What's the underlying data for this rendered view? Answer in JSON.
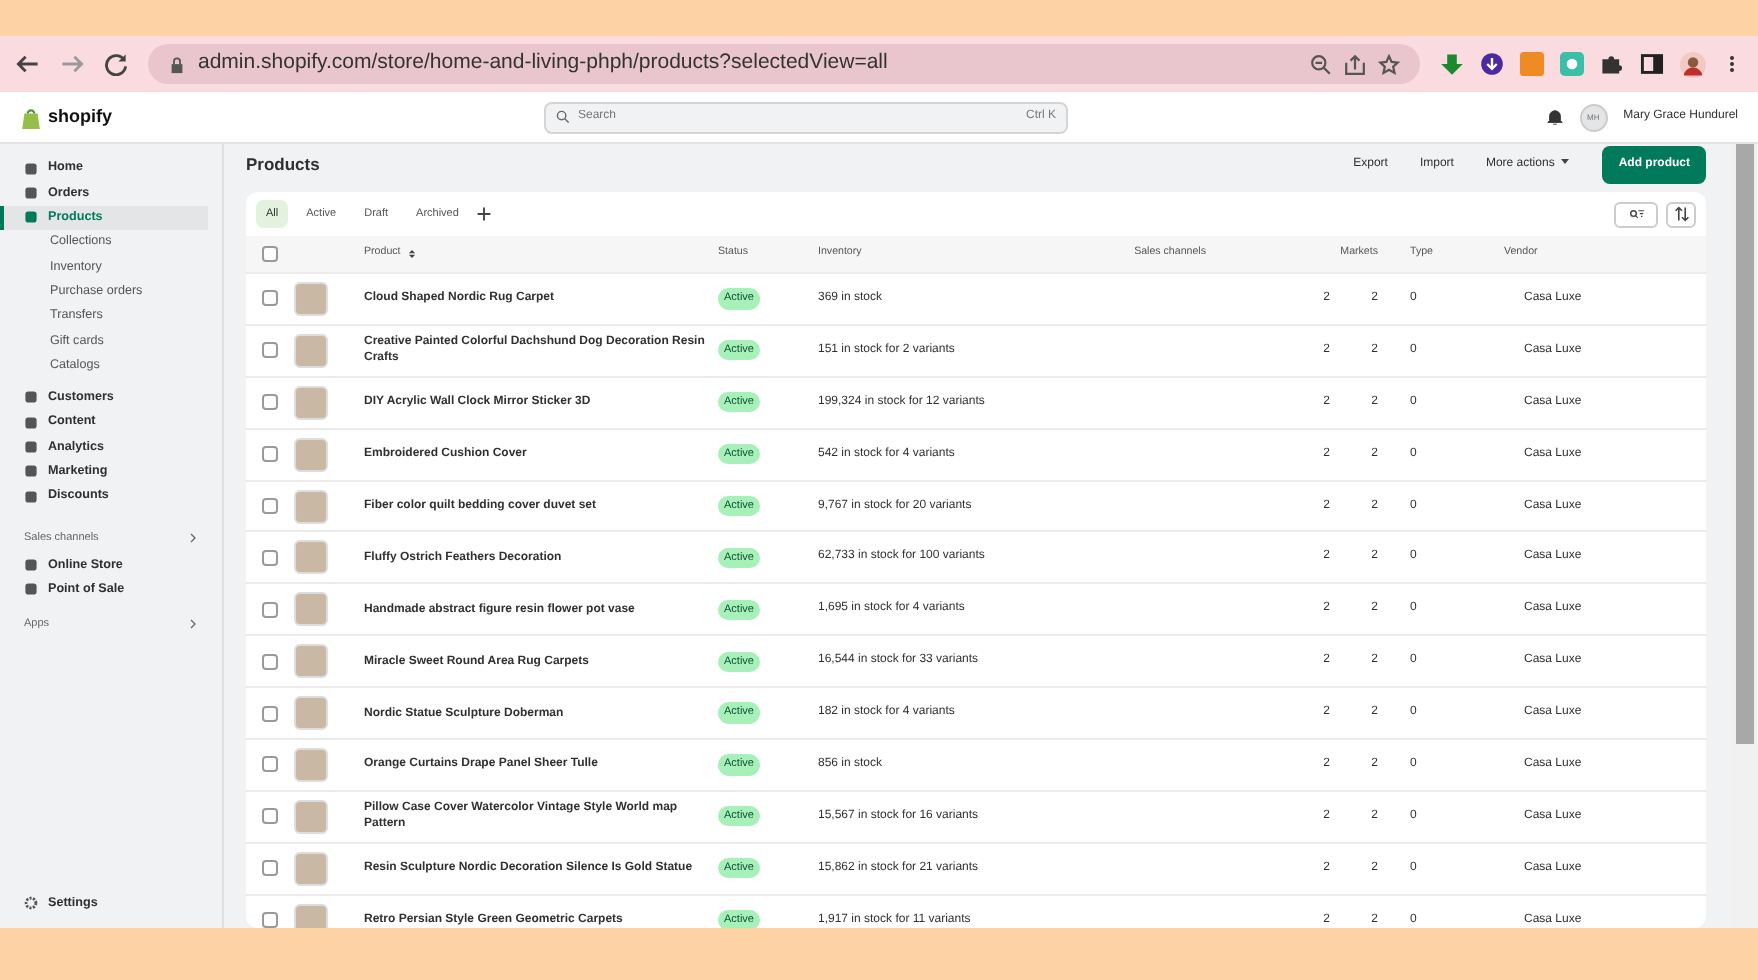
{
  "browser": {
    "url": "admin.shopify.com/store/home-and-living-phph/products?selectedView=all"
  },
  "topbar": {
    "logo": "shopify",
    "search": {
      "placeholder": "Search",
      "shortcut": "Ctrl K"
    },
    "avatar_initials": "MH",
    "user": "Mary Grace Hundurel"
  },
  "sidebar": {
    "items": [
      {
        "label": "Home",
        "kind": "main",
        "selected": false
      },
      {
        "label": "Orders",
        "kind": "main",
        "selected": false
      },
      {
        "label": "Products",
        "kind": "main",
        "selected": true
      },
      {
        "label": "Collections",
        "kind": "sub",
        "selected": false
      },
      {
        "label": "Inventory",
        "kind": "sub",
        "selected": false
      },
      {
        "label": "Purchase orders",
        "kind": "sub",
        "selected": false
      },
      {
        "label": "Transfers",
        "kind": "sub",
        "selected": false
      },
      {
        "label": "Gift cards",
        "kind": "sub",
        "selected": false
      },
      {
        "label": "Catalogs",
        "kind": "sub",
        "selected": false
      },
      {
        "label": "Customers",
        "kind": "main",
        "selected": false
      },
      {
        "label": "Content",
        "kind": "main",
        "selected": false
      },
      {
        "label": "Analytics",
        "kind": "main",
        "selected": false
      },
      {
        "label": "Marketing",
        "kind": "main",
        "selected": false
      },
      {
        "label": "Discounts",
        "kind": "main",
        "selected": false
      },
      {
        "label": "Sales channels",
        "kind": "section"
      },
      {
        "label": "Online Store",
        "kind": "main",
        "selected": false
      },
      {
        "label": "Point of Sale",
        "kind": "main",
        "selected": false
      },
      {
        "label": "Apps",
        "kind": "section"
      }
    ],
    "settings": "Settings"
  },
  "page": {
    "title": "Products",
    "actions": [
      "Export",
      "Import",
      "More actions"
    ],
    "primary": "Add product"
  },
  "tabs": [
    {
      "label": "All",
      "selected": true
    },
    {
      "label": "Active",
      "selected": false
    },
    {
      "label": "Draft",
      "selected": false
    },
    {
      "label": "Archived",
      "selected": false
    }
  ],
  "table": {
    "select_all_checked": false,
    "columns": [
      "Product",
      "Status",
      "Inventory",
      "Sales channels",
      "Markets",
      "Type",
      "Vendor"
    ],
    "rows": [
      {
        "product": "Cloud Shaped Nordic Rug Carpet",
        "status": "Active",
        "inventory": "369 in stock",
        "sales_channels": "2",
        "markets": "2",
        "type": "0",
        "vendor": "Casa Luxe",
        "checked": false
      },
      {
        "product": "Creative Painted Colorful Dachshund Dog Decoration Resin Crafts",
        "status": "Active",
        "inventory": "151 in stock for 2 variants",
        "sales_channels": "2",
        "markets": "2",
        "type": "0",
        "vendor": "Casa Luxe",
        "checked": false
      },
      {
        "product": "DIY Acrylic Wall Clock Mirror Sticker 3D",
        "status": "Active",
        "inventory": "199,324 in stock for 12 variants",
        "sales_channels": "2",
        "markets": "2",
        "type": "0",
        "vendor": "Casa Luxe",
        "checked": false
      },
      {
        "product": "Embroidered Cushion Cover",
        "status": "Active",
        "inventory": "542 in stock for 4 variants",
        "sales_channels": "2",
        "markets": "2",
        "type": "0",
        "vendor": "Casa Luxe",
        "checked": false
      },
      {
        "product": "Fiber color quilt bedding cover duvet set",
        "status": "Active",
        "inventory": "9,767 in stock for 20 variants",
        "sales_channels": "2",
        "markets": "2",
        "type": "0",
        "vendor": "Casa Luxe",
        "checked": false
      },
      {
        "product": "Fluffy Ostrich Feathers Decoration",
        "status": "Active",
        "inventory": "62,733 in stock for 100 variants",
        "sales_channels": "2",
        "markets": "2",
        "type": "0",
        "vendor": "Casa Luxe",
        "checked": false
      },
      {
        "product": "Handmade abstract figure resin flower pot vase",
        "status": "Active",
        "inventory": "1,695 in stock for 4 variants",
        "sales_channels": "2",
        "markets": "2",
        "type": "0",
        "vendor": "Casa Luxe",
        "checked": false
      },
      {
        "product": "Miracle Sweet Round Area Rug Carpets",
        "status": "Active",
        "inventory": "16,544 in stock for 33 variants",
        "sales_channels": "2",
        "markets": "2",
        "type": "0",
        "vendor": "Casa Luxe",
        "checked": false
      },
      {
        "product": "Nordic Statue Sculpture Doberman",
        "status": "Active",
        "inventory": "182 in stock for 4 variants",
        "sales_channels": "2",
        "markets": "2",
        "type": "0",
        "vendor": "Casa Luxe",
        "checked": false
      },
      {
        "product": "Orange Curtains Drape Panel Sheer Tulle",
        "status": "Active",
        "inventory": "856 in stock",
        "sales_channels": "2",
        "markets": "2",
        "type": "0",
        "vendor": "Casa Luxe",
        "checked": false
      },
      {
        "product": "Pillow Case Cover Watercolor Vintage Style World map Pattern",
        "status": "Active",
        "inventory": "15,567 in stock for 16 variants",
        "sales_channels": "2",
        "markets": "2",
        "type": "0",
        "vendor": "Casa Luxe",
        "checked": false
      },
      {
        "product": "Resin Sculpture Nordic Decoration Silence Is Gold Statue",
        "status": "Active",
        "inventory": "15,862 in stock for 21 variants",
        "sales_channels": "2",
        "markets": "2",
        "type": "0",
        "vendor": "Casa Luxe",
        "checked": false
      },
      {
        "product": "Retro Persian Style Green Geometric Carpets",
        "status": "Active",
        "inventory": "1,917 in stock for 11 variants",
        "sales_channels": "2",
        "markets": "2",
        "type": "0",
        "vendor": "Casa Luxe",
        "checked": false
      }
    ]
  }
}
